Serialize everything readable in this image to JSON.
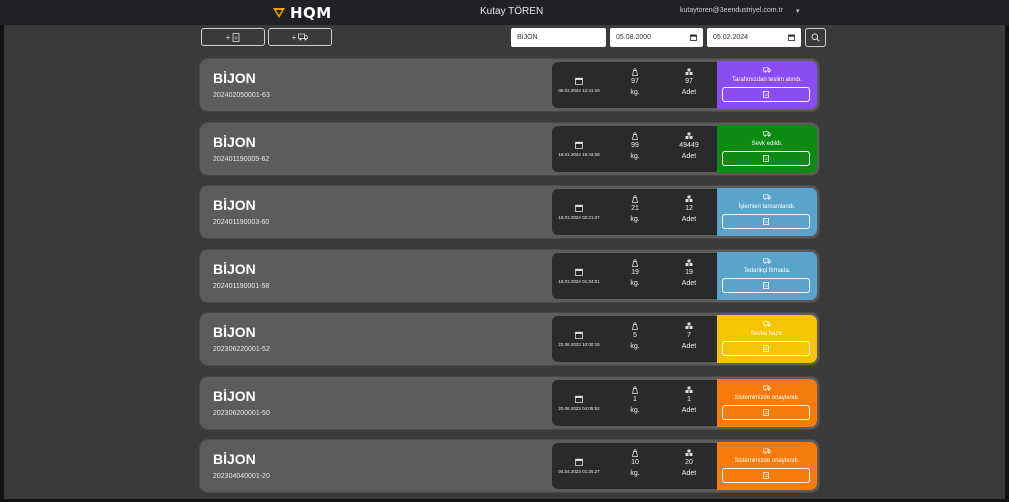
{
  "header": {
    "logo": "HQM",
    "user_name": "Kutay TÖREN",
    "user_email": "kutaytoren@3eendustriyel.com.tr",
    "caret": "▾"
  },
  "toolbar": {
    "new_doc_label": "+",
    "new_shipment_label": "+",
    "search_value": "BİJON",
    "date_from": "05.08.2000",
    "date_to": "05.02.2024"
  },
  "colors": {
    "purple": "#8a4cf3",
    "green": "#0d8a12",
    "blue": "#5aa4cc",
    "yellow": "#f7c400",
    "orange": "#f77b0a"
  },
  "cards": [
    {
      "title": "BİJON",
      "code": "202402050001-63",
      "date": "05.02.2024 12:41:19",
      "kg": "97",
      "kg_unit": "kg.",
      "adet": "97",
      "adet_unit": "Adet",
      "status": "Tarafımızdan teslim alındı.",
      "color": "purple"
    },
    {
      "title": "BİJON",
      "code": "202401190005-62",
      "date": "18.01.2024 15:44:08",
      "kg": "99",
      "kg_unit": "kg.",
      "adet": "49449",
      "adet_unit": "Adet",
      "status": "Sevk edildi.",
      "color": "green"
    },
    {
      "title": "BİJON",
      "code": "202401190003-60",
      "date": "18.01.2024 02:21:47",
      "kg": "21",
      "kg_unit": "kg.",
      "adet": "12",
      "adet_unit": "Adet",
      "status": "İşlemleri tamamlandı.",
      "color": "blue"
    },
    {
      "title": "BİJON",
      "code": "202401190001-58",
      "date": "18.01.2024 01:34:01",
      "kg": "19",
      "kg_unit": "kg.",
      "adet": "19",
      "adet_unit": "Adet",
      "status": "Tedarikçi firmada.",
      "color": "blue"
    },
    {
      "title": "BİJON",
      "code": "202306220001-52",
      "date": "22.06.2023 10:00:18",
      "kg": "5",
      "kg_unit": "kg.",
      "adet": "7",
      "adet_unit": "Adet",
      "status": "Sevke hazır.",
      "color": "yellow"
    },
    {
      "title": "BİJON",
      "code": "202306200001-50",
      "date": "20.06.2023 04:05:52",
      "kg": "1",
      "kg_unit": "kg.",
      "adet": "1",
      "adet_unit": "Adet",
      "status": "Sistemimizde onaylandı.",
      "color": "orange"
    },
    {
      "title": "BİJON",
      "code": "202304040001-20",
      "date": "04.04.2023 01:25:27",
      "kg": "10",
      "kg_unit": "kg.",
      "adet": "20",
      "adet_unit": "Adet",
      "status": "Sistemimizde onaylandı.",
      "color": "orange"
    }
  ]
}
